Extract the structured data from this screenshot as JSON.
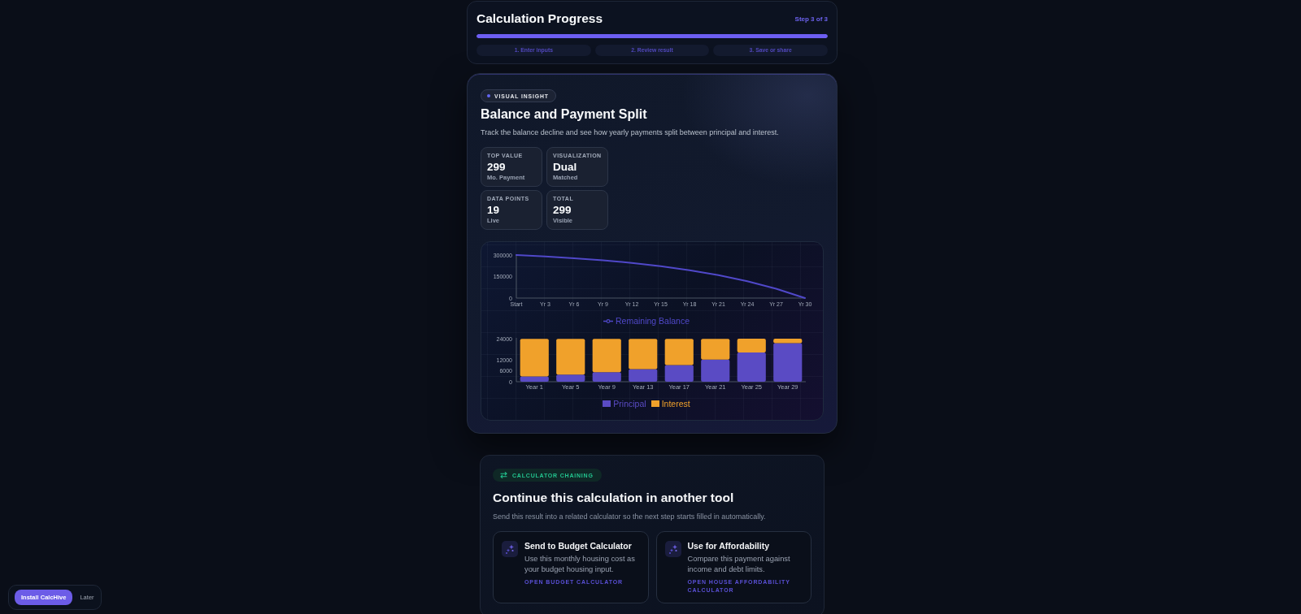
{
  "progress": {
    "title": "Calculation Progress",
    "step_counter": "Step 3 of 3",
    "level": 1,
    "steps": [
      "1. Enter inputs",
      "2. Review result",
      "3. Save or share"
    ]
  },
  "insight": {
    "badge": "VISUAL INSIGHT",
    "title": "Balance and Payment Split",
    "description": "Track the balance decline and see how yearly payments split between principal and interest.",
    "stats": [
      {
        "label": "TOP VALUE",
        "value": "299",
        "caption": "Mo. Payment"
      },
      {
        "label": "VISUALIZATION",
        "value": "Dual",
        "caption": "Matched"
      },
      {
        "label": "DATA POINTS",
        "value": "19",
        "caption": "Live"
      },
      {
        "label": "TOTAL",
        "value": "299",
        "caption": "Visible"
      }
    ],
    "charts": [
      {
        "chart_data": {
          "type": "line",
          "categories": [
            "Start",
            "Yr 3",
            "Yr 6",
            "Yr 9",
            "Yr 12",
            "Yr 15",
            "Yr 18",
            "Yr 21",
            "Yr 24",
            "Yr 27",
            "Yr 30"
          ],
          "series": [
            {
              "name": "Remaining Balance",
              "color": "#5048c9",
              "values": [
                300000,
                290000,
                278000,
                263000,
                245000,
                222000,
                194000,
                160000,
                117000,
                65000,
                0
              ]
            }
          ],
          "ylim": [
            0,
            300000
          ],
          "yticks": [
            0,
            150000,
            300000
          ],
          "legend": "bottom"
        }
      },
      {
        "chart_data": {
          "type": "bar",
          "stacked": true,
          "categories": [
            "Year 1",
            "Year 5",
            "Year 9",
            "Year 13",
            "Year 17",
            "Year 21",
            "Year 25",
            "Year 29"
          ],
          "series": [
            {
              "name": "Principal",
              "color": "#5a4bc4",
              "values": [
                3000,
                4000,
                5300,
                7000,
                9300,
                12300,
                16300,
                21500
              ]
            },
            {
              "name": "Interest",
              "color": "#f0a12b",
              "values": [
                20900,
                19900,
                18600,
                16900,
                14600,
                11600,
                7700,
                2500
              ]
            }
          ],
          "ylim": [
            0,
            24000
          ],
          "yticks": [
            0,
            6000,
            12000,
            24000
          ],
          "legend": "bottom"
        }
      }
    ]
  },
  "chaining": {
    "badge": "CALCULATOR CHAINING",
    "title": "Continue this calculation in another tool",
    "description": "Send this result into a related calculator so the next step starts filled in automatically.",
    "actions": [
      {
        "title": "Send to Budget Calculator",
        "description": "Use this monthly housing cost as your budget housing input.",
        "link": "OPEN BUDGET CALCULATOR"
      },
      {
        "title": "Use for Affordability",
        "description": "Compare this payment against income and debt limits.",
        "link": "OPEN HOUSE AFFORDABILITY CALCULATOR"
      }
    ]
  },
  "install_prompt": {
    "install_label": "Install CalcHive",
    "later_label": "Later"
  }
}
